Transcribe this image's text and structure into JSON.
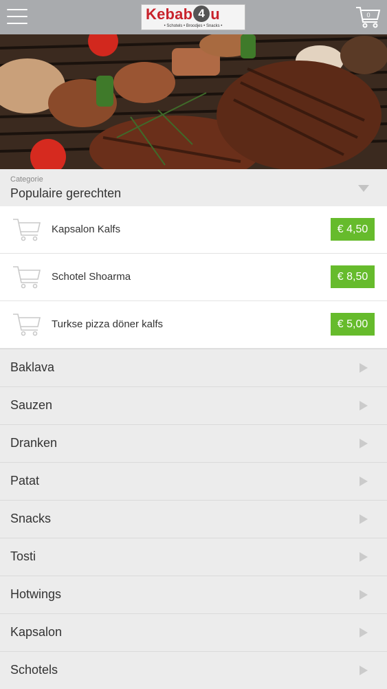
{
  "header": {
    "logo_name_1": "Kebab",
    "logo_name_4": "4",
    "logo_name_2": "u",
    "logo_tagline": "• Schotels • Broodjes • Snacks •",
    "menu_icon": "hamburger-menu-icon",
    "cart_icon": "shopping-cart-icon",
    "cart_count": "0"
  },
  "hero": {
    "image": "grilled-steaks-and-skewers-photo"
  },
  "category": {
    "label": "Categorie",
    "value": "Populaire gerechten",
    "icon": "chevron-down-icon"
  },
  "popular": [
    {
      "name": "Kapsalon Kalfs",
      "price": "€ 4,50"
    },
    {
      "name": "Schotel Shoarma",
      "price": "€ 8,50"
    },
    {
      "name": "Turkse pizza döner kalfs",
      "price": "€ 5,00"
    }
  ],
  "categories": [
    {
      "label": "Baklava"
    },
    {
      "label": "Sauzen"
    },
    {
      "label": "Dranken"
    },
    {
      "label": "Patat"
    },
    {
      "label": "Snacks"
    },
    {
      "label": "Tosti"
    },
    {
      "label": "Hotwings"
    },
    {
      "label": "Kapsalon"
    },
    {
      "label": "Schotels"
    }
  ],
  "colors": {
    "header_bg": "#a9abae",
    "price_green": "#66bb2c",
    "logo_red": "#c8232c",
    "list_bg": "#ececec"
  }
}
